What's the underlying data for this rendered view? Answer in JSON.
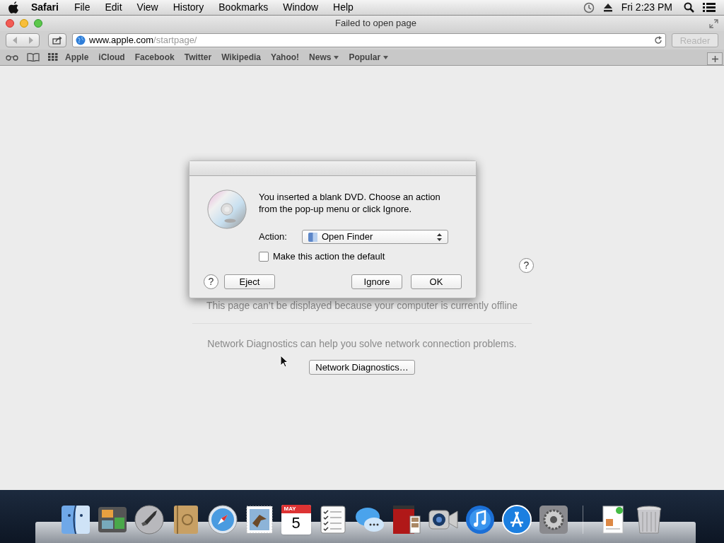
{
  "menu_bar": {
    "app": "Safari",
    "menus": [
      "File",
      "Edit",
      "View",
      "History",
      "Bookmarks",
      "Window",
      "Help"
    ],
    "clock": "Fri 2:23 PM"
  },
  "window": {
    "title": "Failed to open page"
  },
  "toolbar": {
    "url_host": "www.apple.com",
    "url_path": "/startpage/",
    "reader": {
      "label": "Reader",
      "disabled": true
    }
  },
  "bookmarks": [
    {
      "label": "Apple",
      "menu": false
    },
    {
      "label": "iCloud",
      "menu": false
    },
    {
      "label": "Facebook",
      "menu": false
    },
    {
      "label": "Twitter",
      "menu": false
    },
    {
      "label": "Wikipedia",
      "menu": false
    },
    {
      "label": "Yahoo!",
      "menu": false
    },
    {
      "label": "News",
      "menu": true
    },
    {
      "label": "Popular",
      "menu": true
    }
  ],
  "page": {
    "help": "?",
    "message": "This page can’t be displayed because your computer is currently offline",
    "diagnostics_text": "Network Diagnostics can help you solve network connection problems.",
    "diagnostics_button": "Network Diagnostics…"
  },
  "dialog": {
    "help": "?",
    "message": "You inserted a blank DVD. Choose an action from the pop-up menu or click Ignore.",
    "action_label": "Action:",
    "action_value": "Open Finder",
    "checkbox": {
      "label": "Make this action the default",
      "checked": false
    },
    "buttons": [
      "Eject",
      "Ignore",
      "OK"
    ]
  },
  "dock": [
    {
      "kind": "finder"
    },
    {
      "kind": "photos"
    },
    {
      "kind": "launchpad"
    },
    {
      "kind": "contacts"
    },
    {
      "kind": "safari"
    },
    {
      "kind": "mail"
    },
    {
      "kind": "calendar",
      "month": "MAY",
      "day": "5"
    },
    {
      "kind": "reminders"
    },
    {
      "kind": "messages"
    },
    {
      "kind": "photobooth"
    },
    {
      "kind": "facetime"
    },
    {
      "kind": "itunes"
    },
    {
      "kind": "appstore"
    },
    {
      "kind": "preferences"
    },
    {
      "kind": "separator"
    },
    {
      "kind": "document"
    },
    {
      "kind": "trash"
    }
  ]
}
